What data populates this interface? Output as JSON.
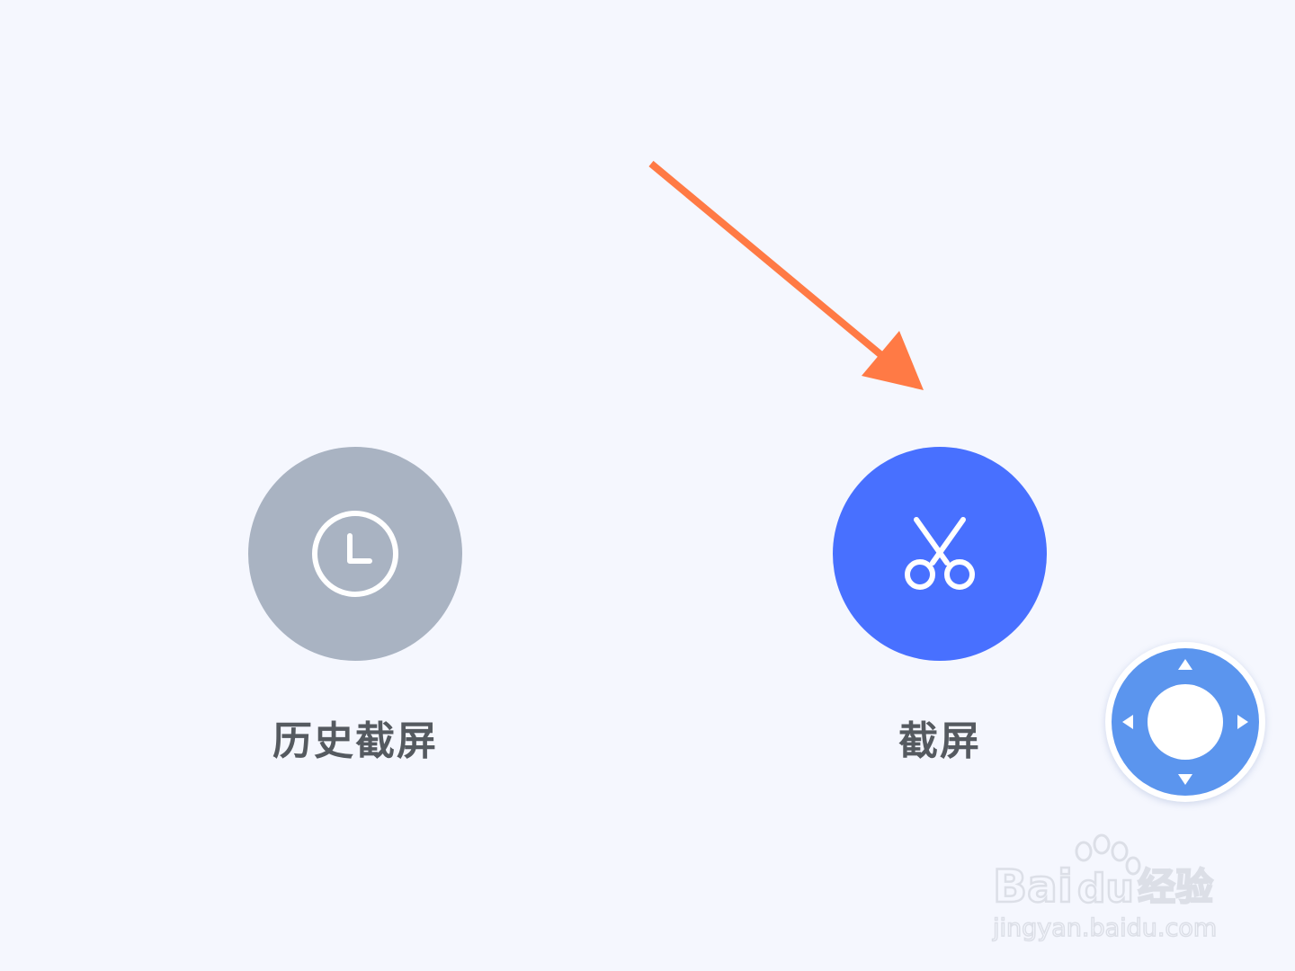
{
  "actions": {
    "history": {
      "label": "历史截屏",
      "icon": "clock-icon"
    },
    "capture": {
      "label": "截屏",
      "icon": "scissors-icon"
    }
  },
  "colors": {
    "background": "#f5f7fe",
    "history_circle": "#a9b3c2",
    "capture_circle": "#4870ff",
    "label_text": "#555a60",
    "arrow": "#ff7a45",
    "joystick": "#5b95ee"
  },
  "joystick": {
    "icon": "joystick-icon"
  },
  "watermark": {
    "brand": "Baidu经验",
    "url": "jingyan.baidu.com"
  }
}
